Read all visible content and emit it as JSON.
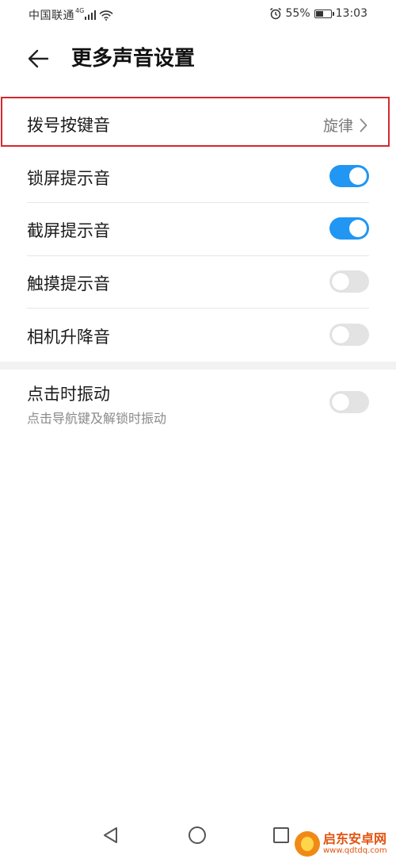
{
  "status_bar": {
    "carrier": "中国联通",
    "network": "4G",
    "battery": "55%",
    "battery_level": 0.55,
    "time": "13:03"
  },
  "header": {
    "title": "更多声音设置"
  },
  "settings": [
    {
      "label": "拨号按键音",
      "value": "旋律"
    },
    {
      "label": "锁屏提示音",
      "toggle": true
    },
    {
      "label": "截屏提示音",
      "toggle": true
    },
    {
      "label": "触摸提示音",
      "toggle": false
    },
    {
      "label": "相机升降音",
      "toggle": false
    }
  ],
  "vibration": {
    "label": "点击时振动",
    "subtitle": "点击导航键及解锁时振动",
    "toggle": false
  },
  "watermark": {
    "name": "启东安卓网",
    "url": "www.qdtdq.com"
  },
  "colors": {
    "accent": "#2196f3",
    "highlight": "#d6272e"
  }
}
